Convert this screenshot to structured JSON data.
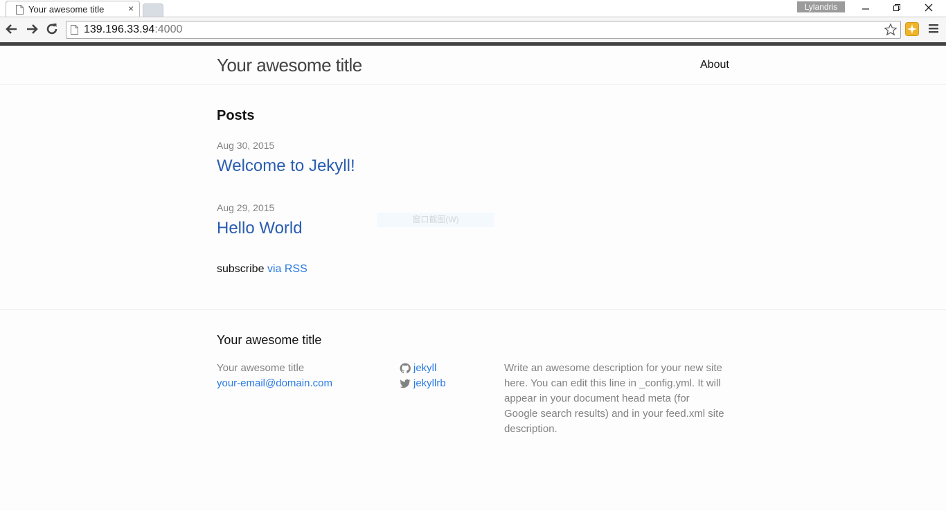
{
  "browser": {
    "tab_title": "Your awesome title",
    "tab_close": "×",
    "profile_name": "Lylandris",
    "url_host": "139.196.33.94",
    "url_port": ":4000"
  },
  "site": {
    "title": "Your awesome title",
    "nav": {
      "about": "About"
    }
  },
  "posts": {
    "heading": "Posts",
    "items": [
      {
        "date": "Aug 30, 2015",
        "title": "Welcome to Jekyll!"
      },
      {
        "date": "Aug 29, 2015",
        "title": "Hello World"
      }
    ],
    "rss_prefix": "subscribe",
    "rss_link": "via RSS"
  },
  "overlay": {
    "ghost_tooltip": "窗口截图(W)"
  },
  "footer": {
    "heading": "Your awesome title",
    "name": "Your awesome title",
    "email": "your-email@domain.com",
    "github": "jekyll",
    "twitter": "jekyllrb",
    "description": "Write an awesome description for your new site here. You can edit this line in _config.yml. It will appear in your document head meta (for Google search results) and in your feed.xml site description."
  },
  "icons": [
    "page-icon",
    "back-arrow-icon",
    "forward-arrow-icon",
    "reload-icon",
    "bookmark-star-icon",
    "extension-icon",
    "menu-icon",
    "github-icon",
    "twitter-icon",
    "minimize-icon",
    "restore-icon",
    "close-icon"
  ],
  "colors": {
    "link": "#2a7ae2",
    "post_link": "#2a5db0",
    "meta": "#828282",
    "chrome_bar": "#424242"
  }
}
